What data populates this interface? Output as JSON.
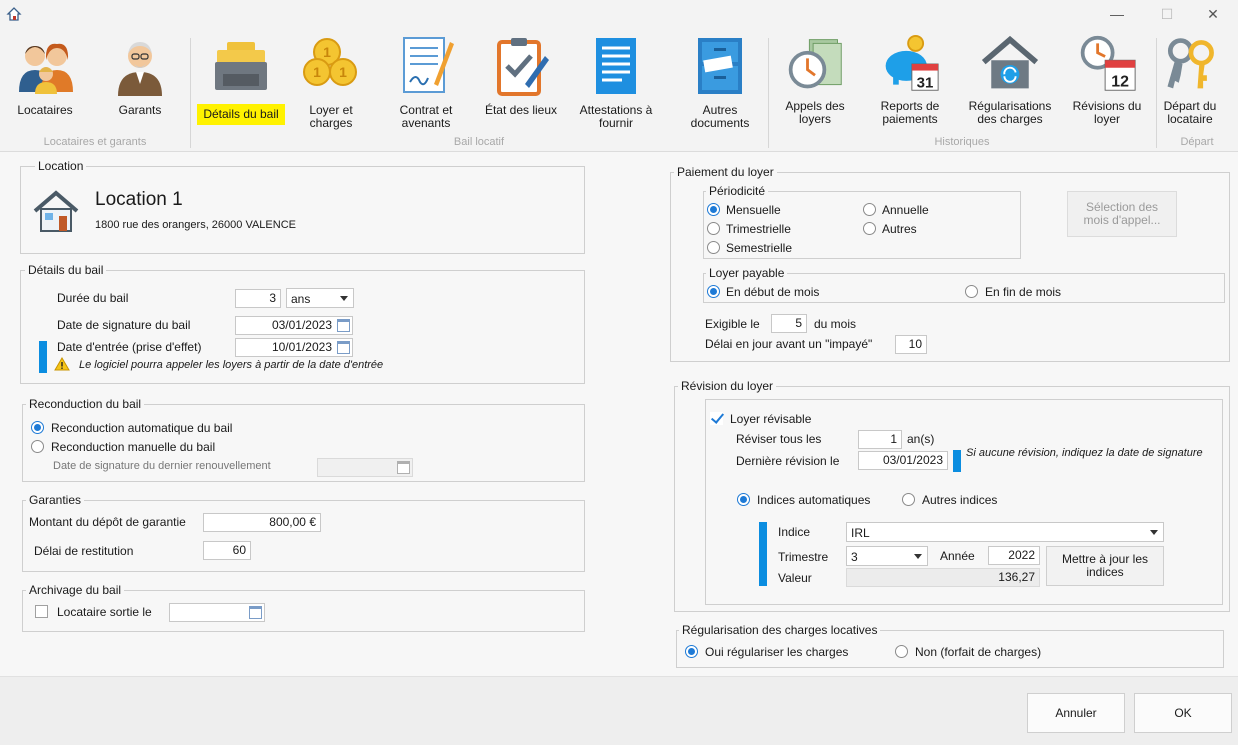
{
  "window": {
    "minimize": "—",
    "maximize": "☐",
    "close": "✕"
  },
  "ribbon": {
    "buttons": [
      {
        "label": "Locataires",
        "icon": "tenants-icon"
      },
      {
        "label": "Garants",
        "icon": "guarantor-icon"
      },
      {
        "label": "Détails du bail",
        "icon": "lease-details-icon"
      },
      {
        "label": "Loyer et charges",
        "icon": "coins-icon"
      },
      {
        "label": "Contrat et avenants",
        "icon": "contract-icon"
      },
      {
        "label": "État des lieux",
        "icon": "checklist-icon"
      },
      {
        "label": "Attestations à fournir",
        "icon": "document-icon"
      },
      {
        "label": "Autres documents",
        "icon": "cabinet-icon"
      },
      {
        "label": "Appels des loyers",
        "icon": "clock-bills-icon"
      },
      {
        "label": "Reports de paiements",
        "icon": "piggy-bank-icon"
      },
      {
        "label": "Régularisations des charges",
        "icon": "house-refresh-icon"
      },
      {
        "label": "Révisions du loyer",
        "icon": "clock-calendar-icon"
      },
      {
        "label": "Départ du locataire",
        "icon": "keys-icon"
      }
    ],
    "groups": {
      "locataires": "Locataires et garants",
      "bail": "Bail locatif",
      "historiques": "Historiques",
      "depart": "Départ"
    },
    "calendar_day": "31",
    "calendar_month_day": "12"
  },
  "location": {
    "group_title": "Location",
    "name": "Location 1",
    "address": "1800 rue des orangers, 26000 VALENCE"
  },
  "details": {
    "group_title": "Détails du bail",
    "duree_label": "Durée du bail",
    "duree_value": "3",
    "duree_unit": "ans",
    "signature_label": "Date de signature du bail",
    "signature_value": "03/01/2023",
    "entree_label": "Date d'entrée (prise d'effet)",
    "entree_value": "10/01/2023",
    "warning": "Le logiciel pourra appeler les loyers à partir de la date d'entrée"
  },
  "reconduction": {
    "group_title": "Reconduction du bail",
    "auto_label": "Reconduction automatique du bail",
    "manual_label": "Reconduction manuelle du bail",
    "last_renewal_label": "Date de signature du dernier renouvellement",
    "last_renewal_value": ""
  },
  "garanties": {
    "group_title": "Garanties",
    "depot_label": "Montant du dépôt de garantie",
    "depot_value": "800,00 €",
    "delai_label": "Délai de restitution",
    "delai_value": "60"
  },
  "archivage": {
    "group_title": "Archivage du bail",
    "sortie_label": "Locataire sortie le",
    "sortie_value": ""
  },
  "paiement": {
    "group_title": "Paiement du loyer",
    "periodicite_title": "Périodicité",
    "mensuelle": "Mensuelle",
    "trimestrielle": "Trimestrielle",
    "semestrielle": "Semestrielle",
    "annuelle": "Annuelle",
    "autres": "Autres",
    "selection_button": "Sélection des mois d'appel...",
    "payable_title": "Loyer payable",
    "debut_mois": "En début de mois",
    "fin_mois": "En fin de mois",
    "exigible_label": "Exigible le",
    "exigible_value": "5",
    "du_mois": "du mois",
    "delai_impaye_label": "Délai en jour avant un \"impayé\"",
    "delai_impaye_value": "10"
  },
  "revision": {
    "group_title": "Révision du loyer",
    "revisable_label": "Loyer révisable",
    "reviser_label": "Réviser tous les",
    "reviser_value": "1",
    "reviser_unit": "an(s)",
    "derniere_label": "Dernière révision le",
    "derniere_value": "03/01/2023",
    "hint": "Si aucune révision, indiquez la date de signature",
    "auto_indices": "Indices automatiques",
    "autres_indices": "Autres indices",
    "indice_label": "Indice",
    "indice_value": "IRL",
    "trimestre_label": "Trimestre",
    "trimestre_value": "3",
    "annee_label": "Année",
    "annee_value": "2022",
    "valeur_label": "Valeur",
    "valeur_value": "136,27",
    "update_button": "Mettre à jour les indices"
  },
  "regularisation": {
    "group_title": "Régularisation des charges locatives",
    "oui": "Oui régulariser les charges",
    "non": "Non (forfait de charges)"
  },
  "footer": {
    "cancel": "Annuler",
    "ok": "OK"
  }
}
